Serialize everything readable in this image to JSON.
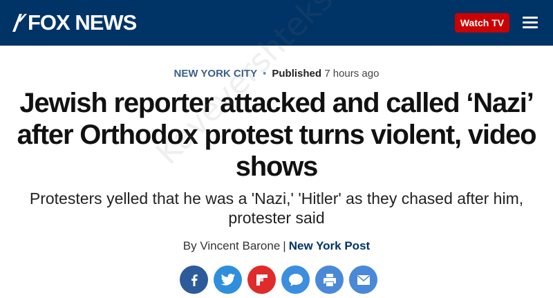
{
  "header": {
    "logo_text": "FOX NEWS",
    "watch_label": "Watch TV",
    "background_color": "#003366",
    "watch_color": "#cc0000",
    "menu_icon": "hamburger-menu-icon"
  },
  "article": {
    "category": "NEW YORK CITY",
    "published_label": "Published",
    "published_time": "7 hours ago",
    "headline": "Jewish reporter attacked and called ‘Nazi’ after Orthodox protest turns violent, video shows",
    "subheadline": "Protesters yelled that he was a 'Nazi,' 'Hitler' as they chased after him, protester said",
    "byline_prefix": "By Vincent Barone",
    "byline_separator": "|",
    "source": "New York Post"
  },
  "share_buttons": [
    {
      "icon": "facebook-icon",
      "color": "#2d5a9a"
    },
    {
      "icon": "twitter-icon",
      "color": "#2f8fdc"
    },
    {
      "icon": "flipboard-icon",
      "color": "#e02b2b"
    },
    {
      "icon": "comment-icon",
      "color": "#3b8ee0"
    },
    {
      "icon": "print-icon",
      "color": "#4a88d8"
    },
    {
      "icon": "email-icon",
      "color": "#4a88d8"
    }
  ],
  "watermark_text": "Kavevershtekst.com"
}
